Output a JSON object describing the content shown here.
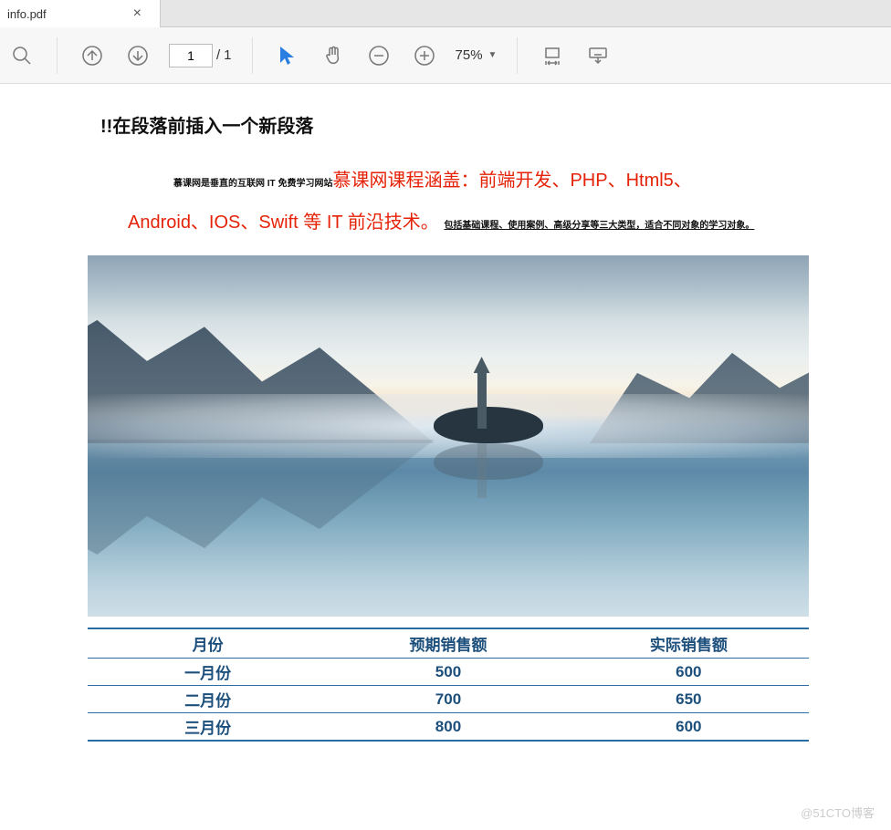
{
  "tab": {
    "title": "info.pdf"
  },
  "toolbar": {
    "current_page": "1",
    "total_pages": "1",
    "page_sep": "/",
    "zoom": "75%"
  },
  "doc": {
    "heading": "!!在段落前插入一个新段落",
    "prefix_small": "慕课网是垂直的互联网 IT 免费学习网站",
    "red_line1": "慕课网课程涵盖：前端开发、PHP、Html5、",
    "red_line2": "Android、IOS、Swift 等 IT 前沿技术。",
    "suffix_small": "包括基础课程、使用案例、高级分享等三大类型，适合不同对象的学习对象。"
  },
  "table": {
    "headers": [
      "月份",
      "预期销售额",
      "实际销售额"
    ],
    "rows": [
      {
        "month": "一月份",
        "expected": "500",
        "actual": "600"
      },
      {
        "month": "二月份",
        "expected": "700",
        "actual": "650"
      },
      {
        "month": "三月份",
        "expected": "800",
        "actual": "600"
      }
    ]
  },
  "watermark": "@51CTO博客",
  "chart_data": {
    "type": "table",
    "title": "",
    "columns": [
      "月份",
      "预期销售额",
      "实际销售额"
    ],
    "rows": [
      [
        "一月份",
        500,
        600
      ],
      [
        "二月份",
        700,
        650
      ],
      [
        "三月份",
        800,
        600
      ]
    ]
  }
}
